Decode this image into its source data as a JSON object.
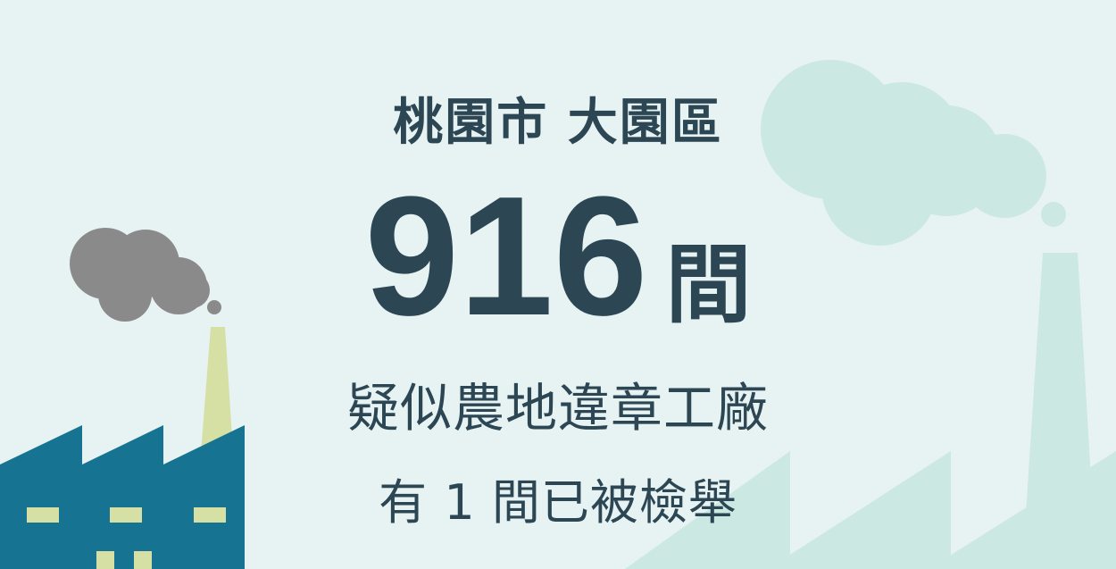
{
  "location": {
    "city": "桃園市",
    "district": "大園區"
  },
  "count": {
    "number": "916",
    "unit": "間"
  },
  "description": "疑似農地違章工廠",
  "reported": {
    "prefix": "有",
    "number": "1",
    "suffix": "間已被檢舉"
  },
  "colors": {
    "background": "#e6f3f2",
    "text": "#2c4654",
    "factory": "#167492",
    "factory_window": "#d6e0a4",
    "smoke_dark": "#8a8a8a",
    "faded_shape": "#cce8e3"
  },
  "icons": [
    "factory-icon",
    "smoke-cloud-icon",
    "faded-factory-icon",
    "faded-cloud-icon"
  ]
}
